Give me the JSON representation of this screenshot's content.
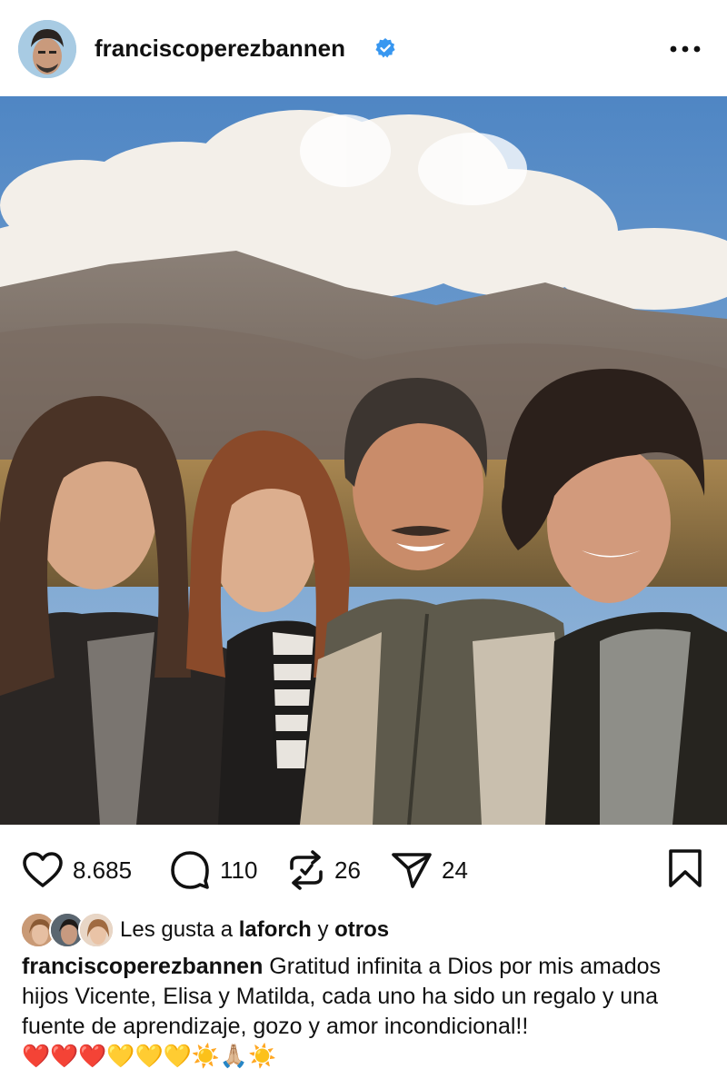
{
  "post": {
    "username": "franciscoperezbannen",
    "verified": true,
    "more_icon": "more-horizontal-icon"
  },
  "photo": {
    "alt": "Family photo in front of mountains"
  },
  "actions": {
    "likes_count": "8.685",
    "comments_count": "110",
    "reposts_count": "26",
    "shares_count": "24",
    "icons": [
      "heart-icon",
      "comment-icon",
      "repost-icon",
      "share-icon",
      "bookmark-icon"
    ]
  },
  "liked_by": {
    "prefix": "Les gusta a ",
    "user": "laforch",
    "connector": " y ",
    "others": "otros"
  },
  "caption": {
    "username": "franciscoperezbannen",
    "text": " Gratitud infinita a Dios por mis amados hijos Vicente, Elisa y Matilda, cada uno ha sido un regalo y una fuente de aprendizaje, gozo y amor incondicional!! ",
    "emojis": "❤️❤️❤️💛💛💛☀️🙏🏼☀️"
  },
  "colors": {
    "verified_blue": "#3897f0",
    "text": "#111111",
    "background": "#ffffff"
  }
}
